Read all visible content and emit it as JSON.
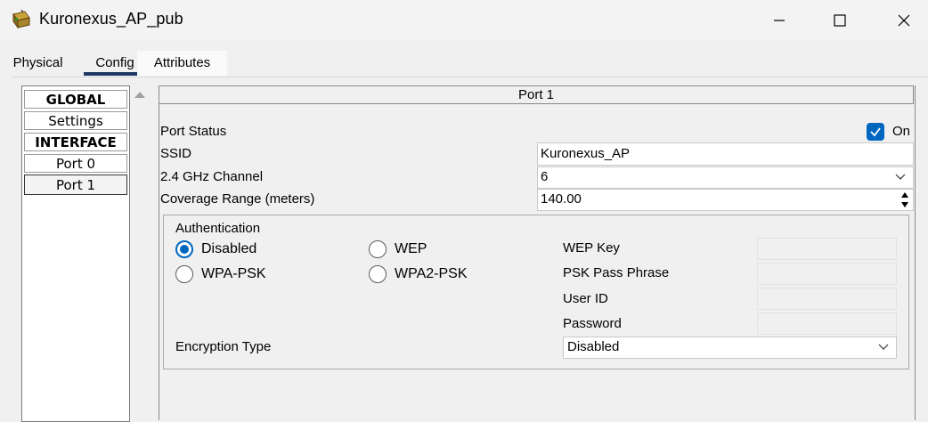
{
  "window": {
    "title": "Kuronexus_AP_pub",
    "icon": "packet-tracer-device-icon"
  },
  "tabs": [
    {
      "label": "Physical"
    },
    {
      "label": "Config"
    },
    {
      "label": "Attributes"
    }
  ],
  "nav": {
    "items": [
      {
        "label": "GLOBAL"
      },
      {
        "label": "Settings"
      },
      {
        "label": "INTERFACE"
      },
      {
        "label": "Port 0"
      },
      {
        "label": "Port 1"
      }
    ]
  },
  "port": {
    "header": "Port 1",
    "status_label": "Port Status",
    "status_checked": true,
    "status_on_label": "On",
    "ssid_label": "SSID",
    "ssid_value": "Kuronexus_AP",
    "channel_label": "2.4 GHz Channel",
    "channel_value": "6",
    "coverage_label": "Coverage Range (meters)",
    "coverage_value": "140.00"
  },
  "auth": {
    "group_label": "Authentication",
    "options": [
      {
        "label": "Disabled",
        "checked": true
      },
      {
        "label": "WEP",
        "checked": false
      },
      {
        "label": "WPA-PSK",
        "checked": false
      },
      {
        "label": "WPA2-PSK",
        "checked": false
      }
    ],
    "wep_key_label": "WEP Key",
    "psk_label": "PSK Pass Phrase",
    "user_id_label": "User ID",
    "password_label": "Password",
    "encryption_label": "Encryption Type",
    "encryption_value": "Disabled"
  },
  "colors": {
    "accent": "#0067c0",
    "tab_underline": "#1f3864"
  }
}
